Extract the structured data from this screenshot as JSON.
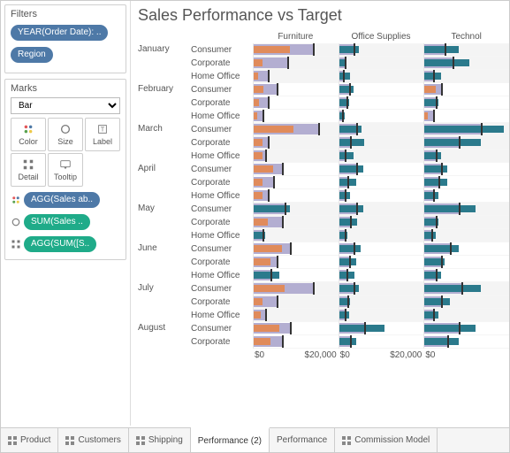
{
  "filters": {
    "title": "Filters",
    "pills": [
      "YEAR(Order Date): ..",
      "Region"
    ]
  },
  "marks": {
    "title": "Marks",
    "type": "Bar",
    "shelves": [
      "Color",
      "Size",
      "Label",
      "Detail",
      "Tooltip"
    ],
    "pills": [
      {
        "label": "AGG(Sales ab..",
        "color": "blue",
        "icon": "color"
      },
      {
        "label": "SUM(Sales ..",
        "color": "teal",
        "icon": "size"
      },
      {
        "label": "AGG(SUM([S..",
        "color": "teal",
        "icon": "detail"
      }
    ]
  },
  "chart": {
    "title": "Sales Performance vs Target",
    "categories": [
      "Furniture",
      "Office Supplies",
      "Technol"
    ],
    "segments": [
      "Consumer",
      "Corporate",
      "Home Office"
    ],
    "months": [
      "January",
      "February",
      "March",
      "April",
      "May",
      "June",
      "July",
      "August"
    ],
    "axis": {
      "ticks": [
        "$0",
        "$20,000"
      ]
    }
  },
  "tabs": [
    {
      "label": "Product",
      "dash": true
    },
    {
      "label": "Customers",
      "dash": true
    },
    {
      "label": "Shipping",
      "dash": true
    },
    {
      "label": "Performance (2)",
      "active": true
    },
    {
      "label": "Performance"
    },
    {
      "label": "Commission Model",
      "dash": true
    }
  ],
  "chart_data": {
    "type": "bar",
    "title": "Sales Performance vs Target",
    "note": "Bullet chart: bg = target, fg = actual sales, color teal if actual>=target else orange. Values are USD.",
    "xlim_per_category": [
      0,
      30000
    ],
    "months": [
      "January",
      "February",
      "March",
      "April",
      "May",
      "June",
      "July",
      "August"
    ],
    "segments": [
      "Consumer",
      "Corporate",
      "Home Office"
    ],
    "categories": [
      "Furniture",
      "Office Supplies",
      "Technology"
    ],
    "rows": [
      {
        "month": "January",
        "segment": "Consumer",
        "Furniture": {
          "actual": 13000,
          "target": 21000
        },
        "Office Supplies": {
          "actual": 7000,
          "target": 5000
        },
        "Technology": {
          "actual": 12000,
          "target": 7000
        }
      },
      {
        "month": "January",
        "segment": "Corporate",
        "Furniture": {
          "actual": 3000,
          "target": 12000
        },
        "Office Supplies": {
          "actual": 2500,
          "target": 2000
        },
        "Technology": {
          "actual": 16000,
          "target": 10000
        }
      },
      {
        "month": "January",
        "segment": "Home Office",
        "Furniture": {
          "actual": 1500,
          "target": 5000
        },
        "Office Supplies": {
          "actual": 4000,
          "target": 1500
        },
        "Technology": {
          "actual": 6000,
          "target": 3000
        }
      },
      {
        "month": "February",
        "segment": "Consumer",
        "Furniture": {
          "actual": 3500,
          "target": 8000
        },
        "Office Supplies": {
          "actual": 5000,
          "target": 3500
        },
        "Technology": {
          "actual": 4000,
          "target": 6000
        }
      },
      {
        "month": "February",
        "segment": "Corporate",
        "Furniture": {
          "actual": 2000,
          "target": 5000
        },
        "Office Supplies": {
          "actual": 3500,
          "target": 2500
        },
        "Technology": {
          "actual": 5000,
          "target": 4000
        }
      },
      {
        "month": "February",
        "segment": "Home Office",
        "Furniture": {
          "actual": 1200,
          "target": 3000
        },
        "Office Supplies": {
          "actual": 2000,
          "target": 1200
        },
        "Technology": {
          "actual": 1000,
          "target": 3000
        }
      },
      {
        "month": "March",
        "segment": "Consumer",
        "Furniture": {
          "actual": 14000,
          "target": 23000
        },
        "Office Supplies": {
          "actual": 8000,
          "target": 6000
        },
        "Technology": {
          "actual": 28000,
          "target": 20000
        }
      },
      {
        "month": "March",
        "segment": "Corporate",
        "Furniture": {
          "actual": 3000,
          "target": 5000
        },
        "Office Supplies": {
          "actual": 9000,
          "target": 4000
        },
        "Technology": {
          "actual": 20000,
          "target": 12000
        }
      },
      {
        "month": "March",
        "segment": "Home Office",
        "Furniture": {
          "actual": 3000,
          "target": 4000
        },
        "Office Supplies": {
          "actual": 5000,
          "target": 2000
        },
        "Technology": {
          "actual": 6000,
          "target": 4000
        }
      },
      {
        "month": "April",
        "segment": "Consumer",
        "Furniture": {
          "actual": 7000,
          "target": 10000
        },
        "Office Supplies": {
          "actual": 8500,
          "target": 6000
        },
        "Technology": {
          "actual": 8000,
          "target": 6000
        }
      },
      {
        "month": "April",
        "segment": "Corporate",
        "Furniture": {
          "actual": 3000,
          "target": 7000
        },
        "Office Supplies": {
          "actual": 6000,
          "target": 3000
        },
        "Technology": {
          "actual": 8000,
          "target": 5000
        }
      },
      {
        "month": "April",
        "segment": "Home Office",
        "Furniture": {
          "actual": 3000,
          "target": 5000
        },
        "Office Supplies": {
          "actual": 4000,
          "target": 2000
        },
        "Technology": {
          "actual": 5000,
          "target": 3000
        }
      },
      {
        "month": "May",
        "segment": "Consumer",
        "Furniture": {
          "actual": 13000,
          "target": 11000
        },
        "Office Supplies": {
          "actual": 8500,
          "target": 6000
        },
        "Technology": {
          "actual": 18000,
          "target": 12000
        }
      },
      {
        "month": "May",
        "segment": "Corporate",
        "Furniture": {
          "actual": 5000,
          "target": 10000
        },
        "Office Supplies": {
          "actual": 6500,
          "target": 4000
        },
        "Technology": {
          "actual": 5000,
          "target": 4000
        }
      },
      {
        "month": "May",
        "segment": "Home Office",
        "Furniture": {
          "actual": 4000,
          "target": 3000
        },
        "Office Supplies": {
          "actual": 3000,
          "target": 2000
        },
        "Technology": {
          "actual": 4000,
          "target": 2500
        }
      },
      {
        "month": "June",
        "segment": "Consumer",
        "Furniture": {
          "actual": 10000,
          "target": 13000
        },
        "Office Supplies": {
          "actual": 7500,
          "target": 5000
        },
        "Technology": {
          "actual": 12000,
          "target": 9000
        }
      },
      {
        "month": "June",
        "segment": "Corporate",
        "Furniture": {
          "actual": 6000,
          "target": 8000
        },
        "Office Supplies": {
          "actual": 6000,
          "target": 3500
        },
        "Technology": {
          "actual": 7000,
          "target": 6000
        }
      },
      {
        "month": "June",
        "segment": "Home Office",
        "Furniture": {
          "actual": 9000,
          "target": 6000
        },
        "Office Supplies": {
          "actual": 5500,
          "target": 2500
        },
        "Technology": {
          "actual": 6000,
          "target": 4000
        }
      },
      {
        "month": "July",
        "segment": "Consumer",
        "Furniture": {
          "actual": 11000,
          "target": 21000
        },
        "Office Supplies": {
          "actual": 7000,
          "target": 5000
        },
        "Technology": {
          "actual": 20000,
          "target": 13000
        }
      },
      {
        "month": "July",
        "segment": "Corporate",
        "Furniture": {
          "actual": 3000,
          "target": 8000
        },
        "Office Supplies": {
          "actual": 4000,
          "target": 3000
        },
        "Technology": {
          "actual": 9000,
          "target": 6000
        }
      },
      {
        "month": "July",
        "segment": "Home Office",
        "Furniture": {
          "actual": 2500,
          "target": 4000
        },
        "Office Supplies": {
          "actual": 3500,
          "target": 2000
        },
        "Technology": {
          "actual": 5000,
          "target": 3000
        }
      },
      {
        "month": "August",
        "segment": "Consumer",
        "Furniture": {
          "actual": 9000,
          "target": 13000
        },
        "Office Supplies": {
          "actual": 16000,
          "target": 9000
        },
        "Technology": {
          "actual": 18000,
          "target": 12000
        }
      },
      {
        "month": "August",
        "segment": "Corporate",
        "Furniture": {
          "actual": 6000,
          "target": 10000
        },
        "Office Supplies": {
          "actual": 6000,
          "target": 4000
        },
        "Technology": {
          "actual": 12000,
          "target": 8000
        }
      }
    ]
  }
}
